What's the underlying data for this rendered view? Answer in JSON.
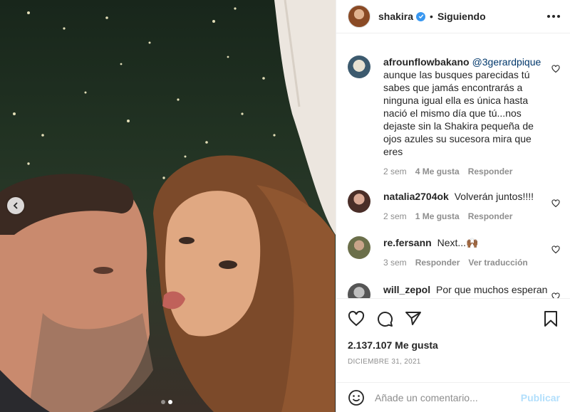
{
  "post": {
    "author": "shakira",
    "separator": "•",
    "follow_status": "Siguiendo",
    "likes": "2.137.107 Me gusta",
    "date": "DICIEMBRE 31, 2021"
  },
  "comments": [
    {
      "user": "afrounflowbakano",
      "mention": "@3gerardpique",
      "text": "aunque las busques parecidas tú sabes que jamás encontrarás a ninguna igual ella es única hasta nació el mismo día que tú...nos dejaste sin la Shakira pequeña de ojos azules su sucesora mira que eres",
      "time": "2 sem",
      "likes": "4 Me gusta",
      "reply": "Responder"
    },
    {
      "user": "natalia2704ok",
      "text": "Volverán juntos!!!!",
      "time": "2 sem",
      "likes": "1 Me gusta",
      "reply": "Responder"
    },
    {
      "user": "re.fersann",
      "text": "Next...🙌🏾",
      "time": "3 sem",
      "reply": "Responder",
      "translate": "Ver traducción"
    },
    {
      "user": "will_zepol",
      "text": "Por que muchos esperan"
    }
  ],
  "add_comment": {
    "placeholder": "Añade un comentario...",
    "publish": "Publicar"
  },
  "carousel": {
    "count": 2,
    "active": 1
  },
  "icons": {
    "verified": "verified-badge-icon",
    "more": "more-options-icon",
    "like": "heart-icon",
    "comment": "comment-bubble-icon",
    "share": "paper-plane-icon",
    "save": "bookmark-icon",
    "emoji": "emoji-icon",
    "prev": "chevron-left-icon"
  },
  "colors": {
    "accent": "#3897f0",
    "publish_disabled": "#b2dffc",
    "meta": "#8e8e8e"
  }
}
